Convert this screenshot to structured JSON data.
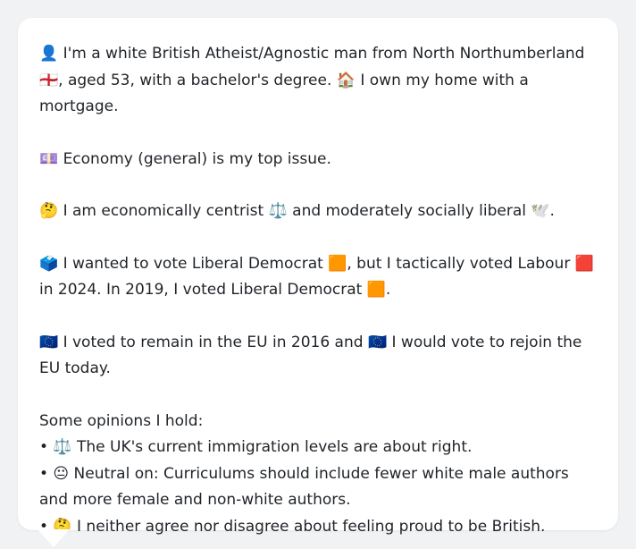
{
  "bio": {
    "paragraphs": [
      "👤 I'm a white British Atheist/Agnostic man from North Northumberland 🏴󠁧󠁢󠁥󠁮󠁧󠁿, aged 53, with a bachelor's degree. 🏠 I own my home with a mortgage.",
      "💷 Economy (general) is my top issue.",
      "🤔 I am economically centrist ⚖️ and moderately socially liberal 🕊️.",
      "🗳️ I wanted to vote Liberal Democrat 🟧, but I tactically voted Labour 🟥 in 2024. In 2019, I voted Liberal Democrat 🟧.",
      "🇪🇺 I voted to remain in the EU in 2016 and 🇪🇺 I would vote to rejoin the EU today."
    ],
    "opinions_heading": "Some opinions I hold:",
    "opinions": [
      "• ⚖️ The UK's current immigration levels are about right.",
      "• 😐 Neutral on: Curriculums should include fewer white male authors and more female and non-white authors.",
      "• 🤔 I neither agree nor disagree about feeling proud to be British."
    ]
  }
}
